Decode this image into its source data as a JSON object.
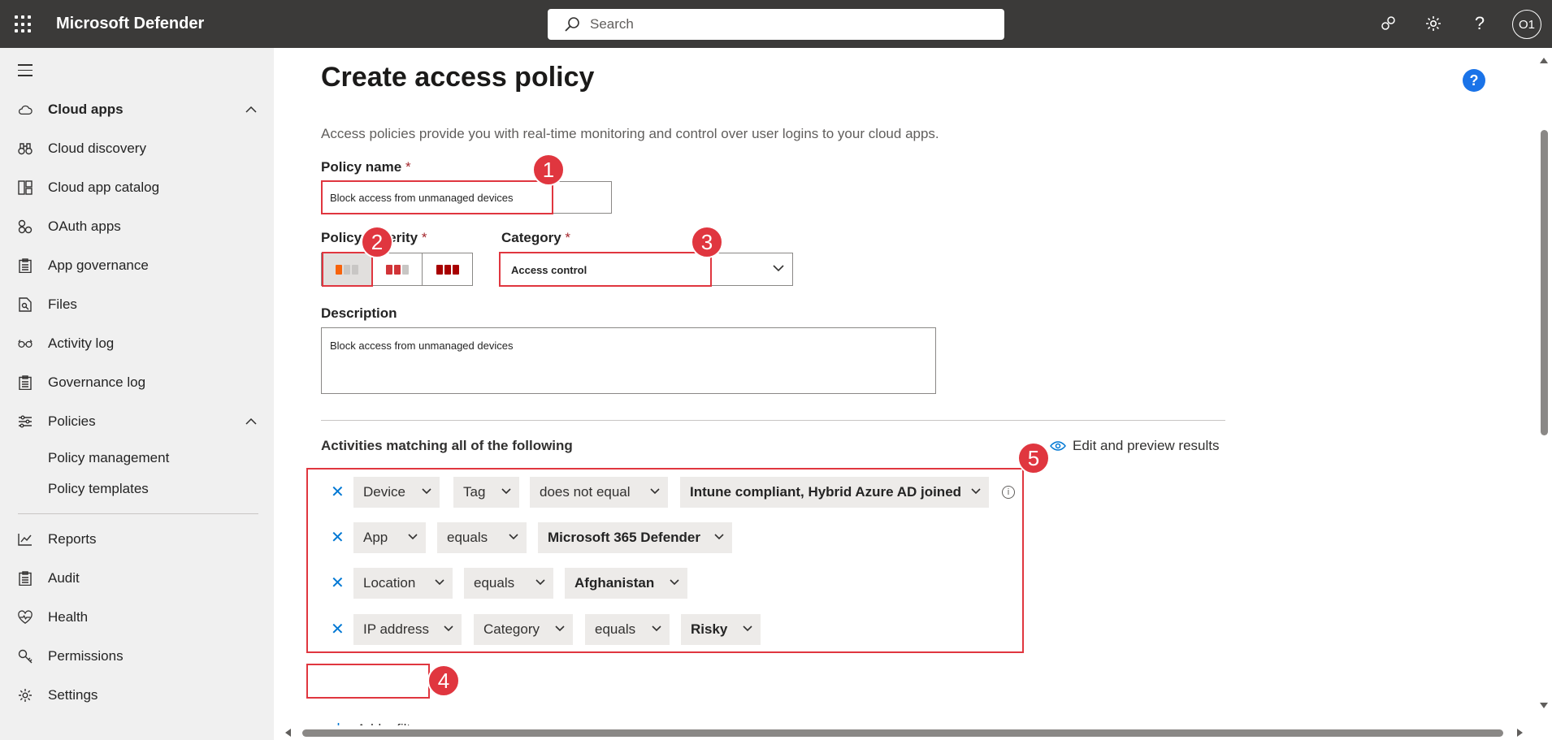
{
  "topbar": {
    "app_title": "Microsoft Defender",
    "search_placeholder": "Search",
    "avatar_initials": "O1"
  },
  "sidebar": {
    "items": [
      {
        "label": "Cloud apps",
        "icon": "cloud-icon",
        "expanded": true
      },
      {
        "label": "Cloud discovery",
        "icon": "binoculars-icon"
      },
      {
        "label": "Cloud app catalog",
        "icon": "catalog-icon"
      },
      {
        "label": "OAuth apps",
        "icon": "oauth-icon"
      },
      {
        "label": "App governance",
        "icon": "clipboard-icon"
      },
      {
        "label": "Files",
        "icon": "file-search-icon"
      },
      {
        "label": "Activity log",
        "icon": "glasses-icon"
      },
      {
        "label": "Governance log",
        "icon": "clipboard-icon"
      },
      {
        "label": "Policies",
        "icon": "sliders-icon",
        "expanded": true
      }
    ],
    "sub_items": [
      "Policy management",
      "Policy templates"
    ],
    "bottom_items": [
      {
        "label": "Reports",
        "icon": "chart-line-icon"
      },
      {
        "label": "Audit",
        "icon": "clipboard-icon"
      },
      {
        "label": "Health",
        "icon": "heart-pulse-icon"
      },
      {
        "label": "Permissions",
        "icon": "key-icon"
      },
      {
        "label": "Settings",
        "icon": "gear-icon"
      }
    ]
  },
  "main": {
    "title": "Create access policy",
    "help": "?",
    "intro": "Access policies provide you with real-time monitoring and control over user logins to your cloud apps.",
    "policy_name_label": "Policy name",
    "policy_name_value": "Block access from unmanaged devices",
    "severity_label": "Policy severity",
    "category_label": "Category",
    "category_value": "Access control",
    "description_label": "Description",
    "description_value": "Block access from unmanaged devices",
    "required_mark": "*",
    "activities_heading": "Activities matching all of the following",
    "preview_link": "Edit and preview results",
    "add_filter_label": "Add a filter",
    "filters": [
      {
        "chips": [
          "Device",
          "Tag",
          "does not equal",
          "Intune compliant, Hybrid Azure AD joined"
        ]
      },
      {
        "chips": [
          "App",
          "equals",
          "Microsoft 365 Defender"
        ]
      },
      {
        "chips": [
          "Location",
          "equals",
          "Afghanistan"
        ]
      },
      {
        "chips": [
          "IP address",
          "Category",
          "equals",
          "Risky"
        ]
      }
    ]
  },
  "annotations": [
    "1",
    "2",
    "3",
    "4",
    "5"
  ],
  "colors": {
    "topbar": "#3b3a39",
    "sidebar": "#f0f0f0",
    "accent": "#0078d4",
    "annotation_red": "#e0363f",
    "severity_low": "#f7630c",
    "severity_medium": "#d13438",
    "severity_high": "#a80000"
  }
}
